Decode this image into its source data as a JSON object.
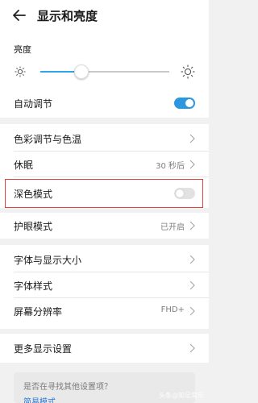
{
  "header": {
    "title": "显示和亮度"
  },
  "brightness": {
    "label": "亮度",
    "level_percent": 32
  },
  "auto_adjust": {
    "label": "自动调节",
    "on": true
  },
  "color": {
    "label": "色彩调节与色温"
  },
  "sleep": {
    "label": "休眠",
    "value": "30 秒后"
  },
  "dark_mode": {
    "label": "深色模式",
    "on": false
  },
  "eye_protect": {
    "label": "护眼模式",
    "value": "已开启"
  },
  "font_size": {
    "label": "字体与显示大小"
  },
  "font_style": {
    "label": "字体样式"
  },
  "resolution": {
    "label": "屏幕分辨率",
    "value": "FHD+"
  },
  "more": {
    "label": "更多显示设置"
  },
  "suggest": {
    "question": "是否在寻找其他设置项？",
    "link": "简易模式"
  },
  "watermark": "头条@知足常乐",
  "colors": {
    "accent": "#2a97e0",
    "highlight": "#e24040"
  }
}
